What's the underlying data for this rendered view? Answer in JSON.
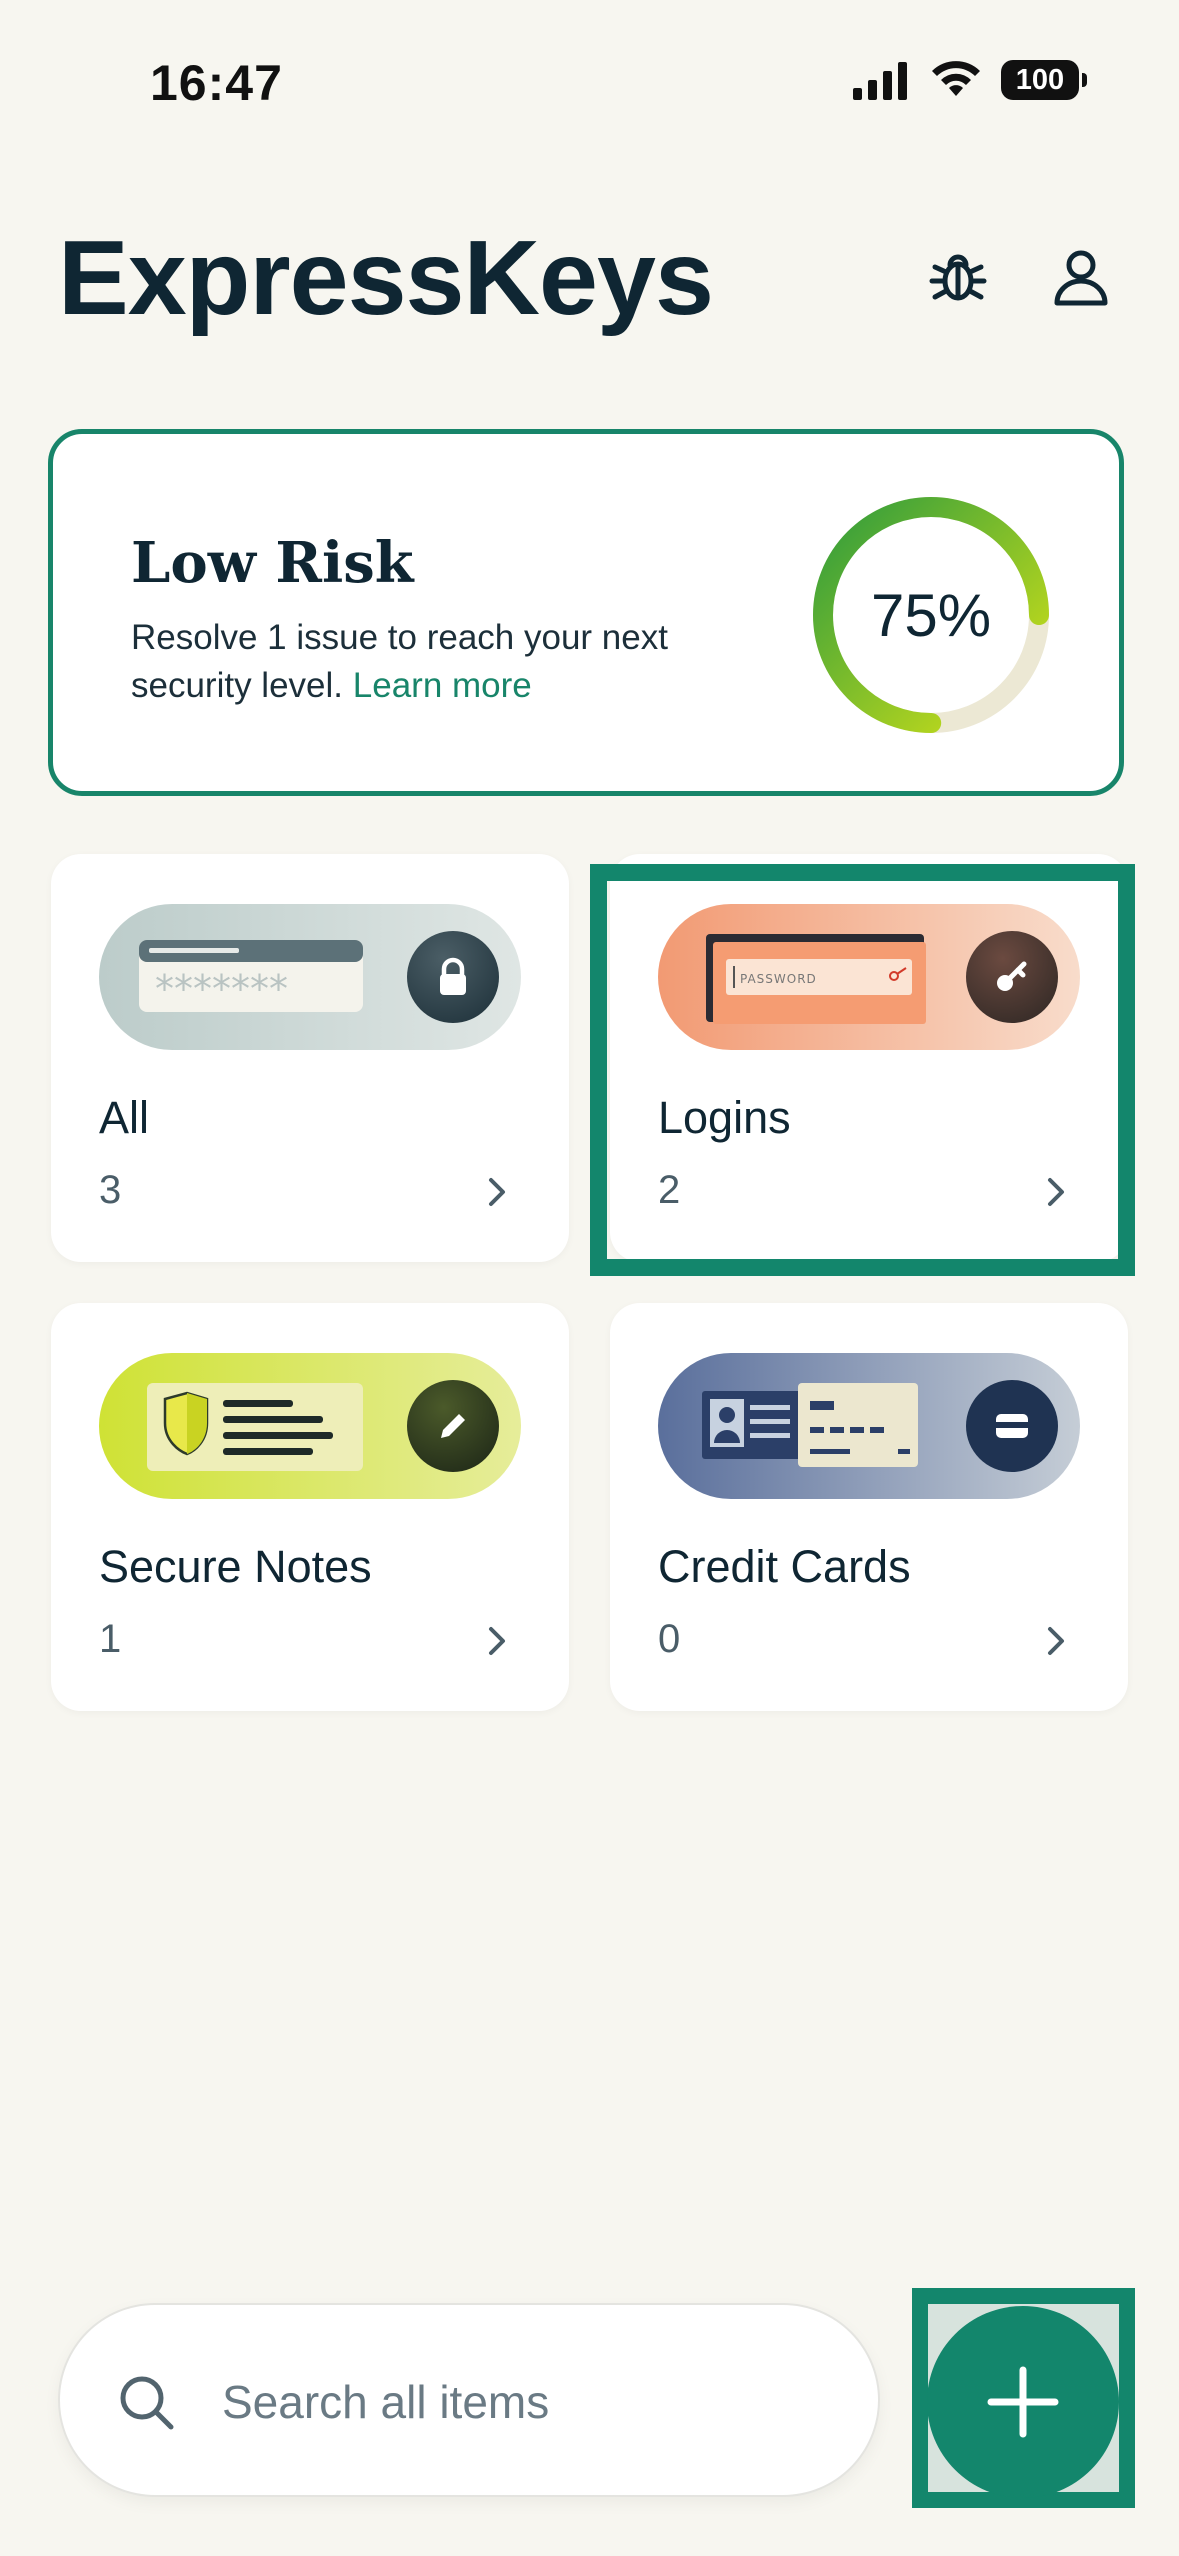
{
  "status_bar": {
    "time": "16:47",
    "battery": "100"
  },
  "header": {
    "title": "ExpressKeys",
    "bug_icon": "bug-icon",
    "user_icon": "user-icon"
  },
  "risk": {
    "title": "Low Risk",
    "description": "Resolve 1 issue to reach your next security level.",
    "learn_more": "Learn more",
    "score_text": "75%",
    "score_fraction": 0.75,
    "colors": {
      "accent": "#18856a",
      "gauge_start": "#2f9b3d",
      "gauge_end": "#d5e317",
      "gauge_track": "#ece8d4"
    }
  },
  "categories": [
    {
      "label": "All",
      "count": "3",
      "icon": "lock-icon"
    },
    {
      "label": "Logins",
      "count": "2",
      "icon": "key-icon",
      "placeholder": "PASSWORD"
    },
    {
      "label": "Secure Notes",
      "count": "1",
      "icon": "pencil-icon"
    },
    {
      "label": "Credit Cards",
      "count": "0",
      "icon": "card-icon"
    }
  ],
  "search": {
    "placeholder": "Search all items"
  },
  "add_button_icon": "plus-icon",
  "colors": {
    "background": "#f7f6f0",
    "brand": "#13866c",
    "text_dark": "#0f2633"
  }
}
